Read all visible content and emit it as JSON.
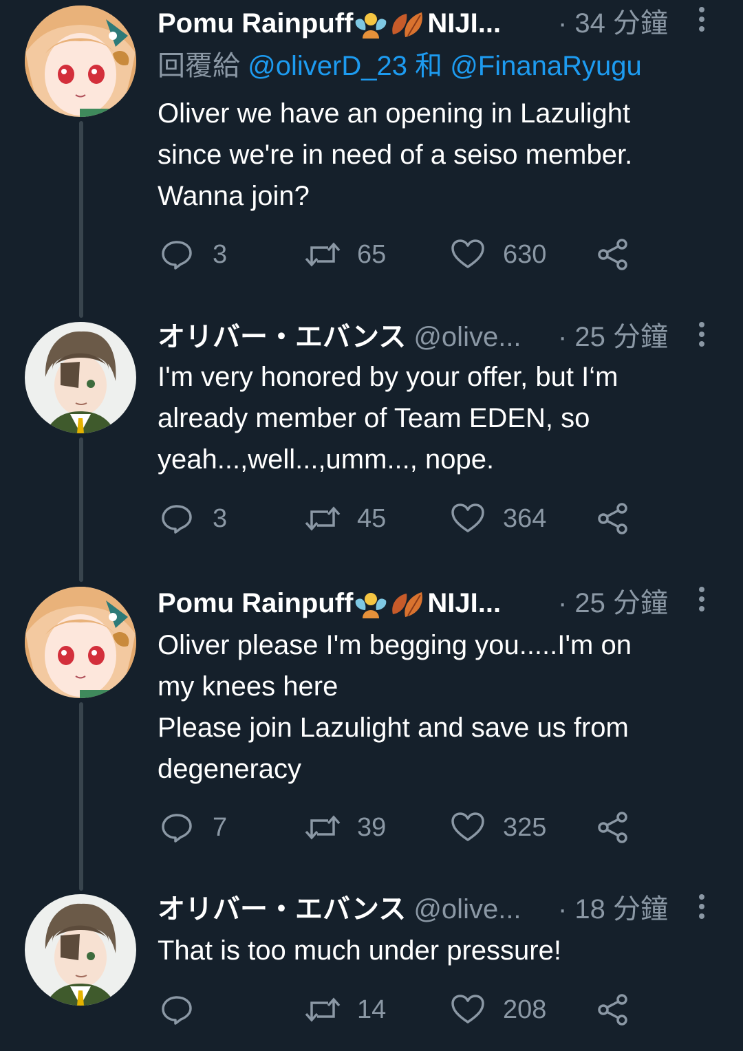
{
  "tweets": [
    {
      "name": "Pomu Rainpuff",
      "name_suffix": "NIJI...",
      "handle": "",
      "time": "· 34 分鐘",
      "reply_prefix": "回覆給",
      "reply_user1": "@oliverD_23",
      "reply_and": "和",
      "reply_user2": "@FinanaRyugu",
      "lines": [
        "Oliver we have an opening in Lazulight",
        "since we're in need of a seiso member.",
        "Wanna join?"
      ],
      "replies": "3",
      "retweets": "65",
      "likes": "630",
      "avatar": "pomu"
    },
    {
      "name": "オリバー・エバンス",
      "name_suffix": "",
      "handle": "@olive...",
      "time": "· 25 分鐘",
      "lines": [
        "I'm very honored by your offer, but I‘m",
        "already member of Team EDEN, so",
        "yeah...,well...,umm..., nope."
      ],
      "replies": "3",
      "retweets": "45",
      "likes": "364",
      "avatar": "oliver"
    },
    {
      "name": "Pomu Rainpuff",
      "name_suffix": "NIJI...",
      "handle": "",
      "time": "· 25 分鐘",
      "lines": [
        "Oliver please I'm begging you.....I'm on",
        "my knees here",
        "Please join Lazulight and save us from",
        "degeneracy"
      ],
      "replies": "7",
      "retweets": "39",
      "likes": "325",
      "avatar": "pomu"
    },
    {
      "name": "オリバー・エバンス",
      "name_suffix": "",
      "handle": "@olive...",
      "time": "· 18 分鐘",
      "lines": [
        "That is too much under pressure!"
      ],
      "replies": "",
      "retweets": "14",
      "likes": "208",
      "avatar": "oliver"
    }
  ],
  "colors": {
    "background": "#15202b",
    "text": "#ffffff",
    "secondary": "#8b98a5",
    "link": "#1d9bf0",
    "thread_line": "#38444d"
  },
  "icons": {
    "reply": "reply-bubble-icon",
    "retweet": "retweet-icon",
    "like": "heart-icon",
    "share": "share-icon",
    "more": "more-vertical-icon",
    "emoji_fairy": "fairy-emoji-icon",
    "emoji_leaves": "leaves-emoji-icon"
  }
}
